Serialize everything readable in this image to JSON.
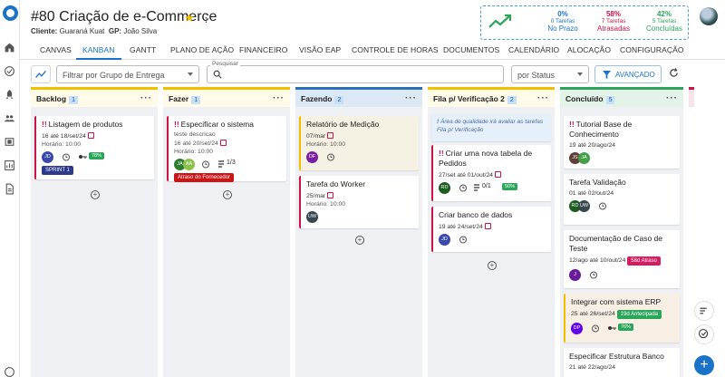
{
  "project": {
    "title": "#80 Criação de e-Commerce",
    "client_label": "Cliente:",
    "client_name": "Guaraná Kuat",
    "gp_label": "GP:",
    "gp_name": "João Silva"
  },
  "stats": [
    {
      "pct": "0%",
      "sub": "0 Tarefas",
      "label": "No Prazo",
      "color": "#1a73c8"
    },
    {
      "pct": "58%",
      "sub": "7 Tarefas",
      "label": "Atrasadas",
      "color": "#cc1447"
    },
    {
      "pct": "42%",
      "sub": "5 Tarefas",
      "label": "Concluídas",
      "color": "#2aa55a"
    }
  ],
  "tabs": [
    "CANVAS",
    "KANBAN",
    "GANTT",
    "PLANO DE AÇÃO",
    "FINANCEIRO",
    "VISÃO EAP",
    "CONTROLE DE HORAS",
    "DOCUMENTOS",
    "CALENDÁRIO",
    "ALOCAÇÃO",
    "CONFIGURAÇÃO"
  ],
  "active_tab": "KANBAN",
  "filters": {
    "group_placeholder": "Filtrar por Grupo de Entrega",
    "search_label": "Pesquisar",
    "status_value": "por Status",
    "advanced_label": "AVANÇADO"
  },
  "columns": [
    {
      "name": "Backlog",
      "count": "1",
      "color": "#f0c000",
      "cards": [
        {
          "title": "Listagem de produtos",
          "urgent": true,
          "date": "16 até 18/set/24",
          "hours": "Horário: 10:00",
          "avatar": "JD",
          "progress": "78%",
          "tag": "SPRINT 1"
        }
      ]
    },
    {
      "name": "Fazer",
      "count": "1",
      "color": "#f0c000",
      "cards": [
        {
          "title": "Especificar o sistema",
          "urgent": true,
          "desc": "teste descricao",
          "date": "16 até 20/set/24",
          "hours": "Horário: 10:00",
          "avatars": [
            "JA",
            "AA"
          ],
          "checklist": "1/3",
          "tag": "Atraso do Fornecedor"
        }
      ]
    },
    {
      "name": "Fazendo",
      "count": "2",
      "color": "#2d6fb6",
      "cards": [
        {
          "title": "Relatório de Medição",
          "date": "07/mar",
          "hours": "Horário: 10:00",
          "avatar": "DF"
        },
        {
          "title": "Tarefa do Worker",
          "date": "25/mar",
          "hours": "Horário: 10:00",
          "avatar": "UW"
        }
      ]
    },
    {
      "name": "Fila p/ Verificação 2",
      "count": "2",
      "color": "#f0c000",
      "info": "Área de qualidade irá avaliar as tarefas Fila p/ Verificação",
      "cards": [
        {
          "title": "Criar uma nova tabela de Pedidos",
          "urgent": true,
          "date": "27/set até 01/out/24",
          "avatar": "RD",
          "checklist": "0/1",
          "progress": "50%"
        },
        {
          "title": "Criar banco de dados",
          "date": "19 até 24/set/24",
          "avatar": "JD"
        }
      ]
    },
    {
      "name": "Concluído",
      "count": "5",
      "color": "#2aa55a",
      "cards": [
        {
          "title": "Tutorial Base de Conhecimento",
          "urgent": true,
          "date": "19 até 20/ago/24",
          "avatars": [
            "JS",
            "JA"
          ]
        },
        {
          "title": "Tarefa Validação",
          "date": "01 até 02/out/24",
          "avatars": [
            "RD",
            "UW"
          ]
        },
        {
          "title": "Documentação de Caso de Teste",
          "date": "12/ago até 10/out/24",
          "badge": "58d Atraso",
          "avatar": "J"
        },
        {
          "title": "Integrar com sistema ERP",
          "date": "25 até 26/set/24",
          "badge": "19d Antecipada",
          "avatar": "DP",
          "progress": "76%"
        },
        {
          "title": "Especificar Estrutura Banco",
          "date": "21 até 22/ago/24"
        }
      ]
    }
  ],
  "colors": {
    "primary": "#1a73c8",
    "urgent": "#cc1447",
    "success": "#2aa55a",
    "warning": "#f0c000"
  }
}
